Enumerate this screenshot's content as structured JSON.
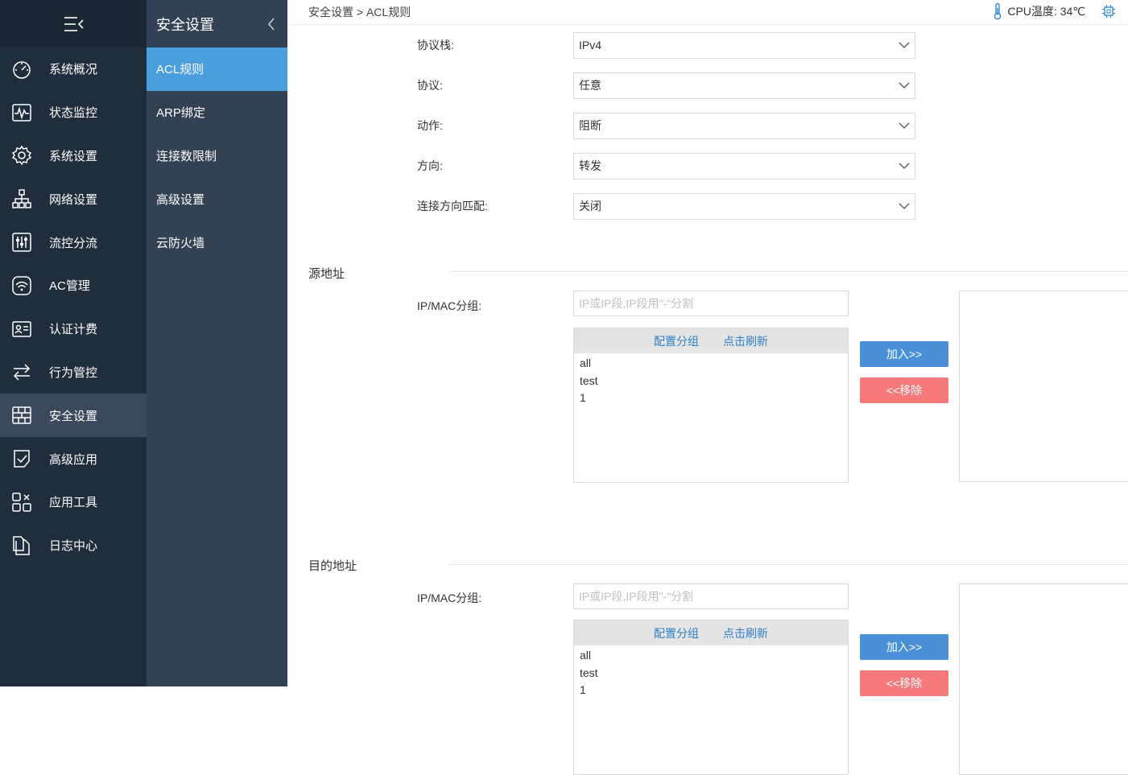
{
  "nav": {
    "items": [
      {
        "label": "系统概况",
        "icon": "gauge-icon"
      },
      {
        "label": "状态监控",
        "icon": "pulse-icon"
      },
      {
        "label": "系统设置",
        "icon": "gear-icon"
      },
      {
        "label": "网络设置",
        "icon": "network-icon"
      },
      {
        "label": "流控分流",
        "icon": "sliders-icon"
      },
      {
        "label": "AC管理",
        "icon": "wifi-icon"
      },
      {
        "label": "认证计费",
        "icon": "id-card-icon"
      },
      {
        "label": "行为管控",
        "icon": "arrows-icon"
      },
      {
        "label": "安全设置",
        "icon": "firewall-icon"
      },
      {
        "label": "高级应用",
        "icon": "check-doc-icon"
      },
      {
        "label": "应用工具",
        "icon": "tools-icon"
      },
      {
        "label": "日志中心",
        "icon": "files-icon"
      }
    ],
    "active_index": 8
  },
  "subnav": {
    "title": "安全设置",
    "items": [
      "ACL规则",
      "ARP绑定",
      "连接数限制",
      "高级设置",
      "云防火墙"
    ],
    "active_index": 0
  },
  "header": {
    "breadcrumb": "安全设置 > ACL规则",
    "cpu_temp": "CPU温度: 34℃"
  },
  "form": {
    "fields": [
      {
        "label": "协议栈:",
        "value": "IPv4"
      },
      {
        "label": "协议:",
        "value": "任意"
      },
      {
        "label": "动作:",
        "value": "阻断"
      },
      {
        "label": "方向:",
        "value": "转发"
      },
      {
        "label": "连接方向匹配:",
        "value": "关闭"
      }
    ]
  },
  "source": {
    "title": "源地址",
    "ip_label": "IP/MAC分组:",
    "placeholder": "IP或IP段,IP段用\"-\"分割",
    "config_link": "配置分组",
    "refresh_link": "点击刷新",
    "groups": [
      "all",
      "test",
      "1"
    ],
    "add_label": "加入>>",
    "remove_label": "<<移除"
  },
  "dest": {
    "title": "目的地址",
    "ip_label": "IP/MAC分组:",
    "placeholder": "IP或IP段,IP段用\"-\"分割",
    "config_link": "配置分组",
    "refresh_link": "点击刷新",
    "groups": [
      "all",
      "test",
      "1"
    ],
    "add_label": "加入>>",
    "remove_label": "<<移除"
  }
}
